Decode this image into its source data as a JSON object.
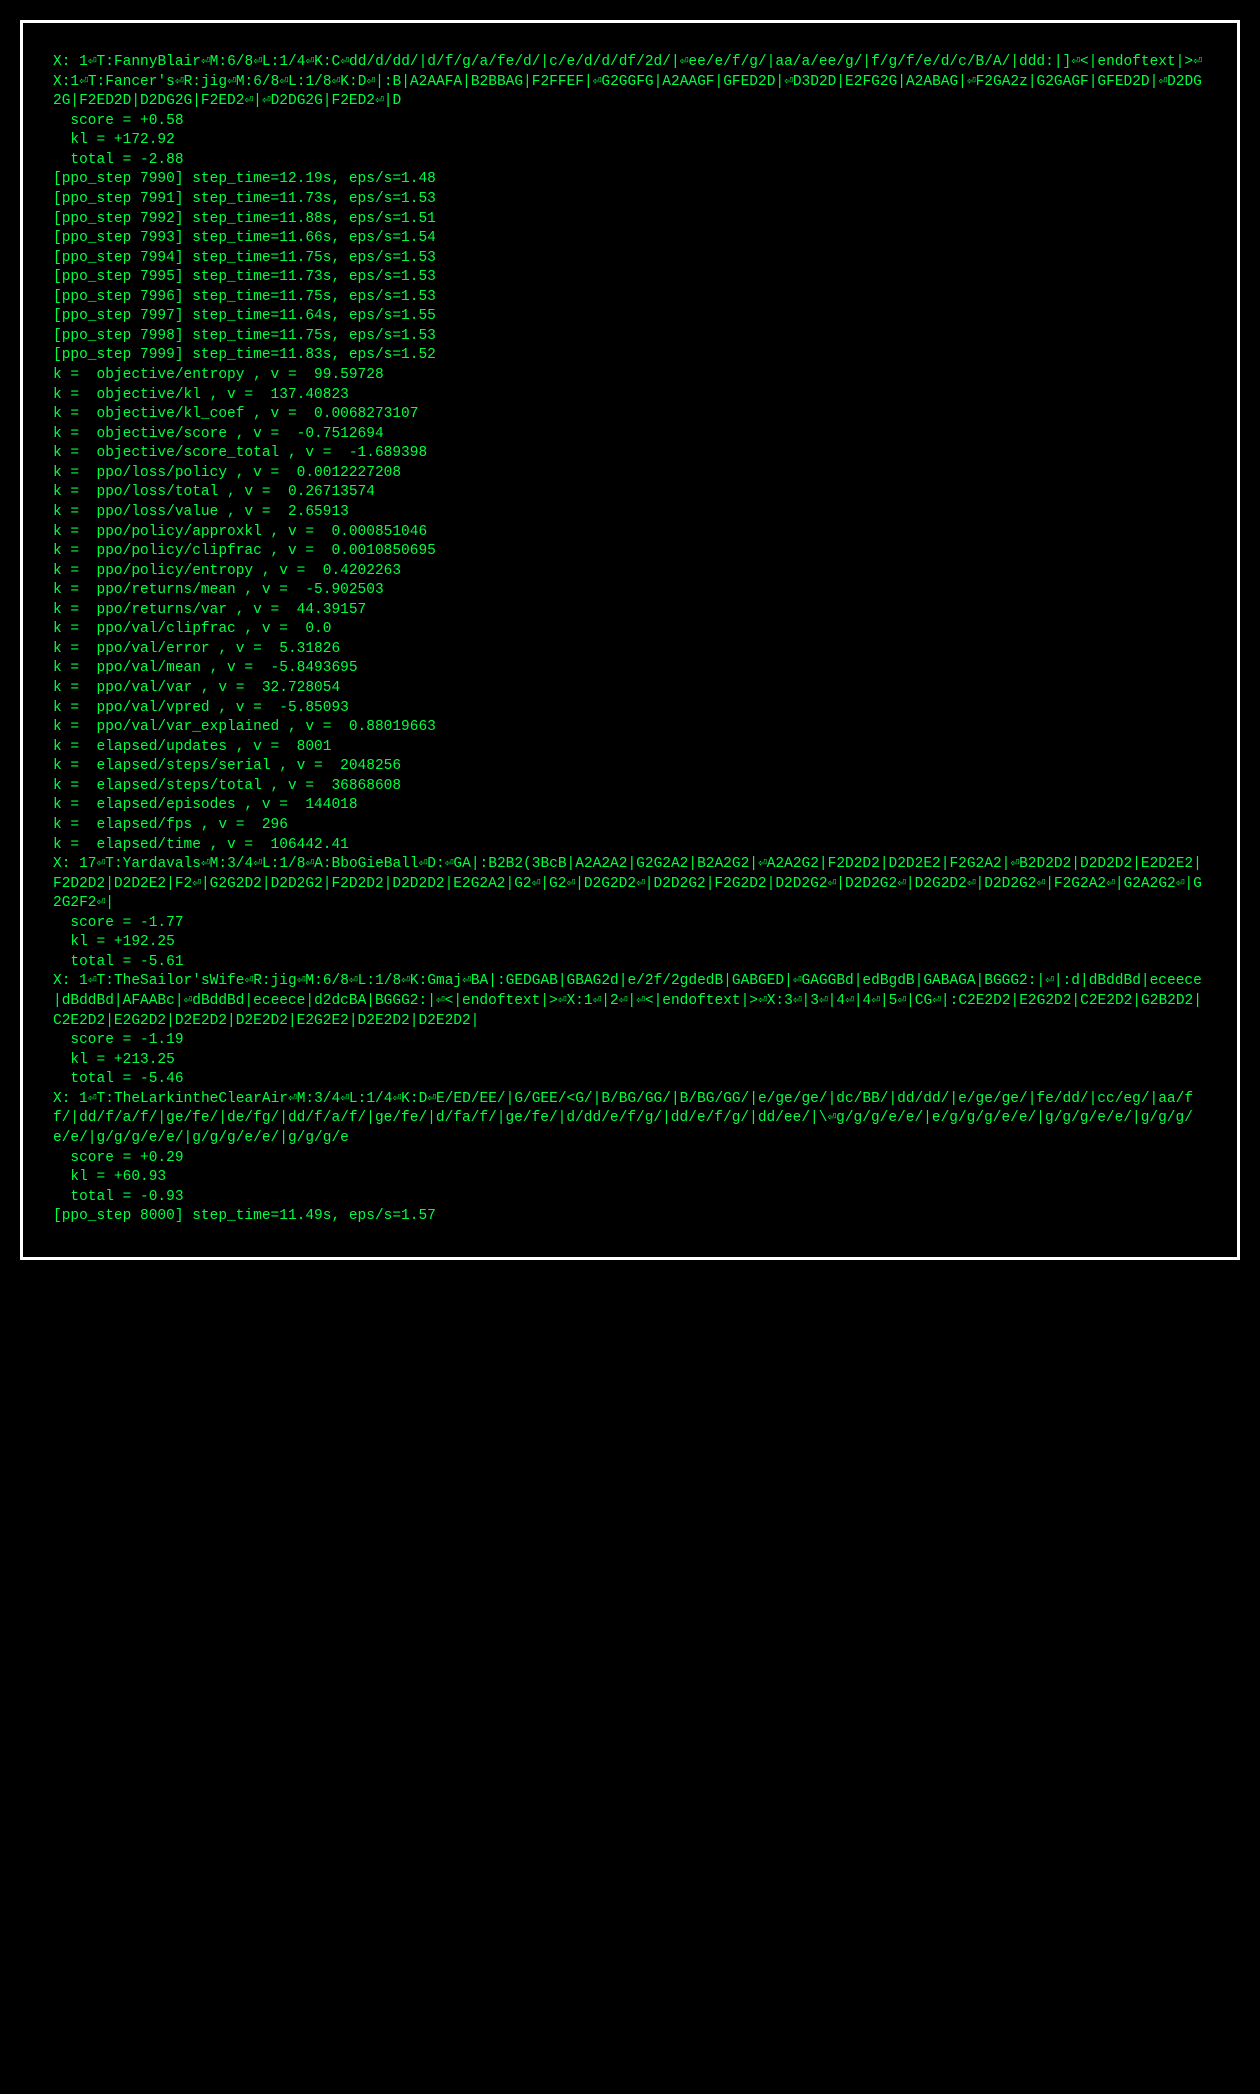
{
  "terminal": {
    "lines": [
      "X: 1⏎T:FannyBlair⏎M:6/8⏎L:1/4⏎K:C⏎dd/d/dd/|d/f/g/a/fe/d/|c/e/d/d/df/2d/|⏎ee/e/f/g/|aa/a/ee/g/|f/g/f/e/d/c/B/A/|ddd:|]⏎<|endoftext|>⏎X:1⏎T:Fancer's⏎R:jig⏎M:6/8⏎L:1/8⏎K:D⏎|:B|A2AAFA|B2BBAG|F2FFEF|⏎G2GGFG|A2AAGF|GFED2D|⏎D3D2D|E2FG2G|A2ABAG|⏎F2GA2z|G2GAGF|GFED2D|⏎D2DG2G|F2ED2D|D2DG2G|F2ED2⏎|⏎D2DG2G|F2ED2⏎|D",
      "  score = +0.58",
      "  kl = +172.92",
      "  total = -2.88",
      "[ppo_step 7990] step_time=12.19s, eps/s=1.48",
      "[ppo_step 7991] step_time=11.73s, eps/s=1.53",
      "[ppo_step 7992] step_time=11.88s, eps/s=1.51",
      "[ppo_step 7993] step_time=11.66s, eps/s=1.54",
      "[ppo_step 7994] step_time=11.75s, eps/s=1.53",
      "[ppo_step 7995] step_time=11.73s, eps/s=1.53",
      "[ppo_step 7996] step_time=11.75s, eps/s=1.53",
      "[ppo_step 7997] step_time=11.64s, eps/s=1.55",
      "[ppo_step 7998] step_time=11.75s, eps/s=1.53",
      "[ppo_step 7999] step_time=11.83s, eps/s=1.52",
      "k =  objective/entropy , v =  99.59728",
      "k =  objective/kl , v =  137.40823",
      "k =  objective/kl_coef , v =  0.0068273107",
      "k =  objective/score , v =  -0.7512694",
      "k =  objective/score_total , v =  -1.689398",
      "k =  ppo/loss/policy , v =  0.0012227208",
      "k =  ppo/loss/total , v =  0.26713574",
      "k =  ppo/loss/value , v =  2.65913",
      "k =  ppo/policy/approxkl , v =  0.000851046",
      "k =  ppo/policy/clipfrac , v =  0.0010850695",
      "k =  ppo/policy/entropy , v =  0.4202263",
      "k =  ppo/returns/mean , v =  -5.902503",
      "k =  ppo/returns/var , v =  44.39157",
      "k =  ppo/val/clipfrac , v =  0.0",
      "k =  ppo/val/error , v =  5.31826",
      "k =  ppo/val/mean , v =  -5.8493695",
      "k =  ppo/val/var , v =  32.728054",
      "k =  ppo/val/vpred , v =  -5.85093",
      "k =  ppo/val/var_explained , v =  0.88019663",
      "k =  elapsed/updates , v =  8001",
      "k =  elapsed/steps/serial , v =  2048256",
      "k =  elapsed/steps/total , v =  36868608",
      "k =  elapsed/episodes , v =  144018",
      "k =  elapsed/fps , v =  296",
      "k =  elapsed/time , v =  106442.41",
      "X: 17⏎T:Yardavals⏎M:3/4⏎L:1/8⏎A:BboGieBall⏎D:⏎GA|:B2B2(3BcB|A2A2A2|G2G2A2|B2A2G2|⏎A2A2G2|F2D2D2|D2D2E2|F2G2A2|⏎B2D2D2|D2D2D2|E2D2E2|F2D2D2|D2D2E2|F2⏎|G2G2D2|D2D2G2|F2D2D2|D2D2D2|E2G2A2|G2⏎|G2⏎|D2G2D2⏎|D2D2G2|F2G2D2|D2D2G2⏎|D2D2G2⏎|D2G2D2⏎|D2D2G2⏎|F2G2A2⏎|G2A2G2⏎|G2G2F2⏎|",
      "  score = -1.77",
      "  kl = +192.25",
      "  total = -5.61",
      "X: 1⏎T:TheSailor'sWife⏎R:jig⏎M:6/8⏎L:1/8⏎K:Gmaj⏎BA|:GEDGAB|GBAG2d|e/2f/2gdedB|GABGED|⏎GAGGBd|edBgdB|GABAGA|BGGG2:|⏎|:d|dBddBd|eceece|dBddBd|AFAABc|⏎dBddBd|eceece|d2dcBA|BGGG2:|⏎<|endoftext|>⏎X:1⏎|2⏎|⏎<|endoftext|>⏎X:3⏎|3⏎|4⏎|4⏎|5⏎|CG⏎|:C2E2D2|E2G2D2|C2E2D2|G2B2D2|C2E2D2|E2G2D2|D2E2D2|D2E2D2|E2G2E2|D2E2D2|D2E2D2|",
      "  score = -1.19",
      "  kl = +213.25",
      "  total = -5.46",
      "X: 1⏎T:TheLarkintheClearAir⏎M:3/4⏎L:1/4⏎K:D⏎E/ED/EE/|G/GEE/<G/|B/BG/GG/|B/BG/GG/|e/ge/ge/|dc/BB/|dd/dd/|e/ge/ge/|fe/dd/|cc/eg/|aa/ff/|dd/f/a/f/|ge/fe/|de/fg/|dd/f/a/f/|ge/fe/|d/fa/f/|ge/fe/|d/dd/e/f/g/|dd/e/f/g/|dd/ee/|\\⏎g/g/g/e/e/|e/g/g/g/e/e/|g/g/g/e/e/|g/g/g/e/e/|g/g/g/e/e/|g/g/g/e/e/|g/g/g/e",
      "  score = +0.29",
      "  kl = +60.93",
      "  total = -0.93",
      "[ppo_step 8000] step_time=11.49s, eps/s=1.57"
    ]
  }
}
